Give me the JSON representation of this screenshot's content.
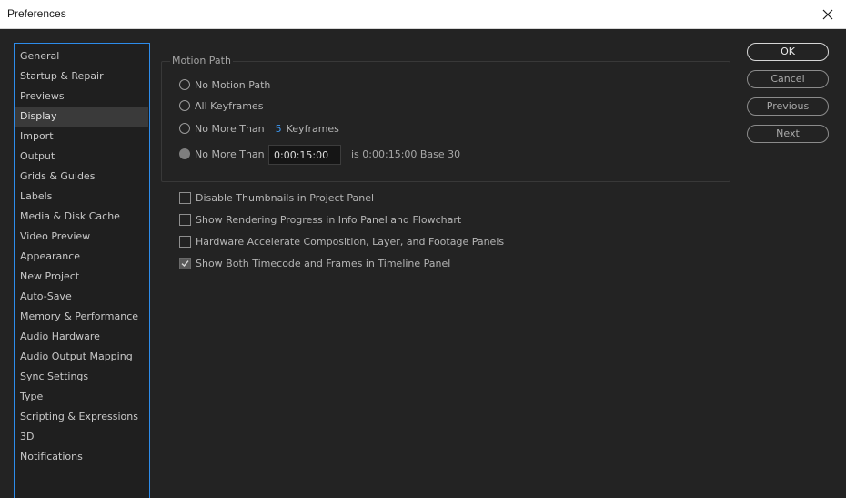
{
  "window": {
    "title": "Preferences",
    "close_icon": "close-icon"
  },
  "sidebar": {
    "items": [
      {
        "label": "General"
      },
      {
        "label": "Startup & Repair"
      },
      {
        "label": "Previews"
      },
      {
        "label": "Display"
      },
      {
        "label": "Import"
      },
      {
        "label": "Output"
      },
      {
        "label": "Grids & Guides"
      },
      {
        "label": "Labels"
      },
      {
        "label": "Media & Disk Cache"
      },
      {
        "label": "Video Preview"
      },
      {
        "label": "Appearance"
      },
      {
        "label": "New Project"
      },
      {
        "label": "Auto-Save"
      },
      {
        "label": "Memory & Performance"
      },
      {
        "label": "Audio Hardware"
      },
      {
        "label": "Audio Output Mapping"
      },
      {
        "label": "Sync Settings"
      },
      {
        "label": "Type"
      },
      {
        "label": "Scripting & Expressions"
      },
      {
        "label": "3D"
      },
      {
        "label": "Notifications"
      }
    ],
    "selected": "Display"
  },
  "motion_path": {
    "group_label": "Motion Path",
    "no_motion_path": "No Motion Path",
    "all_keyframes": "All Keyframes",
    "no_more_than_keyframes": "No More Than",
    "keyframes_count": "5",
    "keyframes_label": "Keyframes",
    "no_more_than_time": "No More Than",
    "time_value": "0:00:15:00",
    "time_info": "is 0:00:15:00  Base 30"
  },
  "options": {
    "disable_thumbnails": {
      "label": "Disable Thumbnails in Project Panel",
      "checked": false
    },
    "show_rendering_progress": {
      "label": "Show Rendering Progress in Info Panel and Flowchart",
      "checked": false
    },
    "hardware_accelerate": {
      "label": "Hardware Accelerate Composition, Layer, and Footage Panels",
      "checked": false
    },
    "show_timecode_frames": {
      "label": "Show Both Timecode and Frames in Timeline Panel",
      "checked": true
    }
  },
  "buttons": {
    "ok": "OK",
    "cancel": "Cancel",
    "previous": "Previous",
    "next": "Next"
  },
  "colors": {
    "accent": "#2d8ceb",
    "link": "#3d98f2",
    "background": "#232323"
  }
}
